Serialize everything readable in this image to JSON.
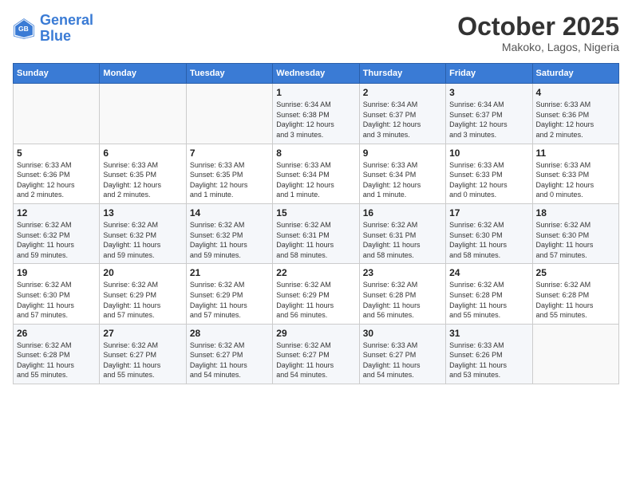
{
  "logo": {
    "line1": "General",
    "line2": "Blue"
  },
  "title": "October 2025",
  "subtitle": "Makoko, Lagos, Nigeria",
  "days_of_week": [
    "Sunday",
    "Monday",
    "Tuesday",
    "Wednesday",
    "Thursday",
    "Friday",
    "Saturday"
  ],
  "weeks": [
    [
      {
        "day": "",
        "info": ""
      },
      {
        "day": "",
        "info": ""
      },
      {
        "day": "",
        "info": ""
      },
      {
        "day": "1",
        "info": "Sunrise: 6:34 AM\nSunset: 6:38 PM\nDaylight: 12 hours\nand 3 minutes."
      },
      {
        "day": "2",
        "info": "Sunrise: 6:34 AM\nSunset: 6:37 PM\nDaylight: 12 hours\nand 3 minutes."
      },
      {
        "day": "3",
        "info": "Sunrise: 6:34 AM\nSunset: 6:37 PM\nDaylight: 12 hours\nand 3 minutes."
      },
      {
        "day": "4",
        "info": "Sunrise: 6:33 AM\nSunset: 6:36 PM\nDaylight: 12 hours\nand 2 minutes."
      }
    ],
    [
      {
        "day": "5",
        "info": "Sunrise: 6:33 AM\nSunset: 6:36 PM\nDaylight: 12 hours\nand 2 minutes."
      },
      {
        "day": "6",
        "info": "Sunrise: 6:33 AM\nSunset: 6:35 PM\nDaylight: 12 hours\nand 2 minutes."
      },
      {
        "day": "7",
        "info": "Sunrise: 6:33 AM\nSunset: 6:35 PM\nDaylight: 12 hours\nand 1 minute."
      },
      {
        "day": "8",
        "info": "Sunrise: 6:33 AM\nSunset: 6:34 PM\nDaylight: 12 hours\nand 1 minute."
      },
      {
        "day": "9",
        "info": "Sunrise: 6:33 AM\nSunset: 6:34 PM\nDaylight: 12 hours\nand 1 minute."
      },
      {
        "day": "10",
        "info": "Sunrise: 6:33 AM\nSunset: 6:33 PM\nDaylight: 12 hours\nand 0 minutes."
      },
      {
        "day": "11",
        "info": "Sunrise: 6:33 AM\nSunset: 6:33 PM\nDaylight: 12 hours\nand 0 minutes."
      }
    ],
    [
      {
        "day": "12",
        "info": "Sunrise: 6:32 AM\nSunset: 6:32 PM\nDaylight: 11 hours\nand 59 minutes."
      },
      {
        "day": "13",
        "info": "Sunrise: 6:32 AM\nSunset: 6:32 PM\nDaylight: 11 hours\nand 59 minutes."
      },
      {
        "day": "14",
        "info": "Sunrise: 6:32 AM\nSunset: 6:32 PM\nDaylight: 11 hours\nand 59 minutes."
      },
      {
        "day": "15",
        "info": "Sunrise: 6:32 AM\nSunset: 6:31 PM\nDaylight: 11 hours\nand 58 minutes."
      },
      {
        "day": "16",
        "info": "Sunrise: 6:32 AM\nSunset: 6:31 PM\nDaylight: 11 hours\nand 58 minutes."
      },
      {
        "day": "17",
        "info": "Sunrise: 6:32 AM\nSunset: 6:30 PM\nDaylight: 11 hours\nand 58 minutes."
      },
      {
        "day": "18",
        "info": "Sunrise: 6:32 AM\nSunset: 6:30 PM\nDaylight: 11 hours\nand 57 minutes."
      }
    ],
    [
      {
        "day": "19",
        "info": "Sunrise: 6:32 AM\nSunset: 6:30 PM\nDaylight: 11 hours\nand 57 minutes."
      },
      {
        "day": "20",
        "info": "Sunrise: 6:32 AM\nSunset: 6:29 PM\nDaylight: 11 hours\nand 57 minutes."
      },
      {
        "day": "21",
        "info": "Sunrise: 6:32 AM\nSunset: 6:29 PM\nDaylight: 11 hours\nand 57 minutes."
      },
      {
        "day": "22",
        "info": "Sunrise: 6:32 AM\nSunset: 6:29 PM\nDaylight: 11 hours\nand 56 minutes."
      },
      {
        "day": "23",
        "info": "Sunrise: 6:32 AM\nSunset: 6:28 PM\nDaylight: 11 hours\nand 56 minutes."
      },
      {
        "day": "24",
        "info": "Sunrise: 6:32 AM\nSunset: 6:28 PM\nDaylight: 11 hours\nand 55 minutes."
      },
      {
        "day": "25",
        "info": "Sunrise: 6:32 AM\nSunset: 6:28 PM\nDaylight: 11 hours\nand 55 minutes."
      }
    ],
    [
      {
        "day": "26",
        "info": "Sunrise: 6:32 AM\nSunset: 6:28 PM\nDaylight: 11 hours\nand 55 minutes."
      },
      {
        "day": "27",
        "info": "Sunrise: 6:32 AM\nSunset: 6:27 PM\nDaylight: 11 hours\nand 55 minutes."
      },
      {
        "day": "28",
        "info": "Sunrise: 6:32 AM\nSunset: 6:27 PM\nDaylight: 11 hours\nand 54 minutes."
      },
      {
        "day": "29",
        "info": "Sunrise: 6:32 AM\nSunset: 6:27 PM\nDaylight: 11 hours\nand 54 minutes."
      },
      {
        "day": "30",
        "info": "Sunrise: 6:33 AM\nSunset: 6:27 PM\nDaylight: 11 hours\nand 54 minutes."
      },
      {
        "day": "31",
        "info": "Sunrise: 6:33 AM\nSunset: 6:26 PM\nDaylight: 11 hours\nand 53 minutes."
      },
      {
        "day": "",
        "info": ""
      }
    ]
  ]
}
